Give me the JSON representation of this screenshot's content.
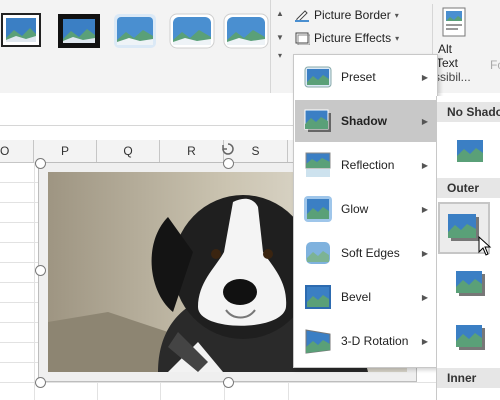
{
  "ribbon": {
    "picture_styles": [
      "style-simple-frame-white",
      "style-simple-frame-black",
      "style-soft-edge",
      "style-rounded",
      "style-reflected"
    ],
    "picture_border_label": "Picture Border",
    "picture_effects_label": "Picture Effects",
    "alt_text_label_line1": "Alt",
    "alt_text_label_line2": "Text",
    "accessibility_label_partial": "ssibil...",
    "next_group_partial": "Fo"
  },
  "sheet": {
    "columns": [
      "O",
      "P",
      "Q",
      "R",
      "S"
    ]
  },
  "picture_effects_menu": {
    "items": [
      {
        "label": "Preset",
        "icon": "preset-icon"
      },
      {
        "label": "Shadow",
        "icon": "shadow-icon"
      },
      {
        "label": "Reflection",
        "icon": "reflection-icon"
      },
      {
        "label": "Glow",
        "icon": "glow-icon"
      },
      {
        "label": "Soft Edges",
        "icon": "soft-edges-icon"
      },
      {
        "label": "Bevel",
        "icon": "bevel-icon"
      },
      {
        "label": "3-D Rotation",
        "icon": "3d-rotation-icon"
      }
    ],
    "active_item": "Shadow"
  },
  "shadow_submenu": {
    "headers": [
      "No Shadow",
      "Outer",
      "Inner"
    ]
  },
  "colors": {
    "ribbon_bg": "#f3f3f3",
    "menu_highlight": "#c8c8c8",
    "thumb_sky": "#3b7fc4",
    "thumb_hill": "#5aa078"
  }
}
